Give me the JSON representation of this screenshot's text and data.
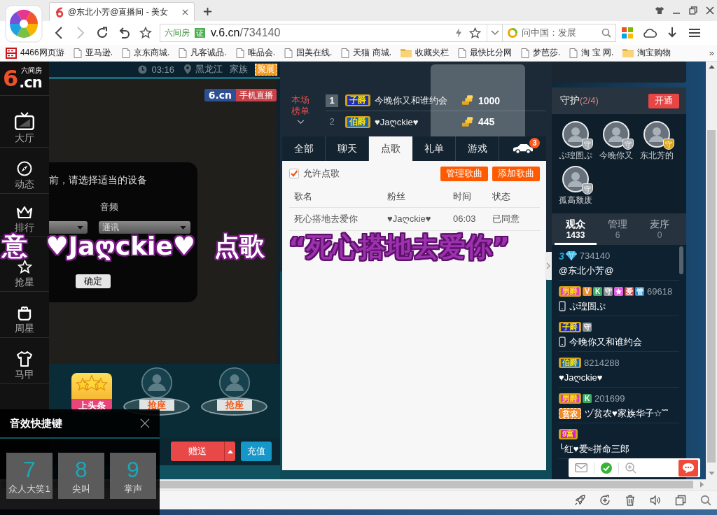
{
  "browser": {
    "tabs": [
      {
        "title": "@东北小芳@直播间 - 美女",
        "selected": true
      }
    ],
    "address": {
      "site": "六间房",
      "cert": "证",
      "host": "v.6.cn",
      "path": "/734140"
    },
    "search": {
      "value": "问中国：发展"
    },
    "bookmarks": [
      {
        "label": "4466网页游",
        "kind": "game"
      },
      {
        "label": "亚马逊.",
        "kind": "page"
      },
      {
        "label": "京东商城.",
        "kind": "page"
      },
      {
        "label": "凡客诚品.",
        "kind": "page"
      },
      {
        "label": "唯品会.",
        "kind": "page"
      },
      {
        "label": "国美在线.",
        "kind": "page"
      },
      {
        "label": "天猫 商城.",
        "kind": "page"
      },
      {
        "label": "收藏夹栏",
        "kind": "folder"
      },
      {
        "label": "最快比分网",
        "kind": "page"
      },
      {
        "label": "梦芭莎.",
        "kind": "page"
      },
      {
        "label": "淘 宝 网.",
        "kind": "page"
      },
      {
        "label": "淘宝购物",
        "kind": "folder"
      }
    ],
    "bookmarks_more": "»"
  },
  "room": {
    "sidebar": {
      "logo": {
        "mark": "6",
        "domain": ".cn",
        "name": "六间房"
      },
      "items": [
        {
          "label": "大厅",
          "kind": "tv"
        },
        {
          "label": "动态",
          "kind": "compass"
        },
        {
          "label": "排行",
          "kind": "crown"
        },
        {
          "label": "抢星",
          "kind": "star"
        },
        {
          "label": "周星",
          "kind": "bag"
        },
        {
          "label": "马甲",
          "kind": "shirt"
        }
      ]
    },
    "host_bar": {
      "time": "03:16",
      "location": "黑龙江",
      "family": "家族",
      "family_badge": "聚展"
    },
    "video": {
      "badge_brand": "6.cn",
      "badge_label": "手机直播"
    },
    "device_dialog": {
      "prompt": "前，请选择适当的设备",
      "audio_label": "音频",
      "audio_device": "通讯",
      "confirm": "确定"
    },
    "overlay": {
      "request": "意 ♥Jaღckie♥ 点歌",
      "song": "“死心搭地去爱你”"
    },
    "seats": [
      {
        "kind": "headline",
        "label": "上头条"
      },
      {
        "kind": "seat",
        "label": "抢座"
      },
      {
        "kind": "seat",
        "label": "抢座"
      }
    ],
    "gift_bar": {
      "send": "赠送",
      "recharge": "充值"
    },
    "ranking": {
      "label": "本场榜单",
      "rows": [
        {
          "rank": "1",
          "top": true,
          "title": "子爵",
          "color": "#1c2fb8",
          "name": "今晚你又和谁约会",
          "coins": "1000"
        },
        {
          "rank": "2",
          "top": false,
          "title": "伯爵",
          "color": "#1466c8",
          "name": "♥Jaღckie♥",
          "coins": "445"
        }
      ]
    },
    "tabs": [
      {
        "kind": "text",
        "label": "全部",
        "selected": false
      },
      {
        "kind": "text",
        "label": "聊天",
        "selected": false
      },
      {
        "kind": "text",
        "label": "点歌",
        "selected": true
      },
      {
        "kind": "text",
        "label": "礼单",
        "selected": false
      },
      {
        "kind": "text",
        "label": "游戏",
        "selected": false
      },
      {
        "kind": "car",
        "badge": "3",
        "selected": false
      }
    ],
    "songs": {
      "allow": {
        "label": "允许点歌",
        "checked": true
      },
      "buttons": [
        "管理歌曲",
        "添加歌曲"
      ],
      "columns": [
        "歌名",
        "粉丝",
        "时间",
        "状态"
      ],
      "rows": [
        [
          "死心搭地去爱你",
          "♥Jaღckie♥",
          "06:03",
          "已同意"
        ]
      ]
    },
    "guard": {
      "title": "守护",
      "count": "(2/4)",
      "open": "开通",
      "members": [
        {
          "name": "ぷ瑝圄ぷ",
          "badge": "守",
          "color": "#a3a9af"
        },
        {
          "name": "今晚你又",
          "badge": "守",
          "color": "#a3a9af"
        },
        {
          "name": "东北芳的",
          "badge": "守",
          "color": "#d9a520"
        },
        {
          "name": "孤高颓废",
          "badge": "守",
          "color": "#a3a9af"
        }
      ]
    },
    "audience_tabs": [
      {
        "label": "观众",
        "count": "1433",
        "selected": true
      },
      {
        "label": "管理",
        "count": "6",
        "selected": false
      },
      {
        "label": "麦序",
        "count": "0",
        "selected": false
      }
    ],
    "audience": [
      {
        "badges": [
          {
            "kind": "level",
            "text": "3"
          },
          {
            "kind": "diamond"
          }
        ],
        "id": "734140",
        "mobile": false,
        "name": "@东北小芳@"
      },
      {
        "badges": [
          {
            "kind": "title",
            "text": "男爵",
            "color": "#e23fc8"
          },
          {
            "kind": "tag",
            "text": "V",
            "color": "#ef8c2a"
          },
          {
            "kind": "tag",
            "text": "K",
            "color": "#3daa66"
          },
          {
            "kind": "tag",
            "text": "守",
            "color": "#8c9298"
          },
          {
            "kind": "star",
            "color": "#e25be0"
          },
          {
            "kind": "tag",
            "text": "爱",
            "color": "#e84545"
          },
          {
            "kind": "tag",
            "text": "管",
            "color": "#2596d8"
          }
        ],
        "id": "69618",
        "mobile": true,
        "name": "ぷ瑝圄ぷ"
      },
      {
        "badges": [
          {
            "kind": "title",
            "text": "子爵",
            "color": "#1c2fb8"
          },
          {
            "kind": "tag",
            "text": "守",
            "color": "#8c9298"
          }
        ],
        "mobile": true,
        "name": "今晚你又和谁约会"
      },
      {
        "badges": [
          {
            "kind": "title",
            "text": "伯爵",
            "color": "#1466c8"
          }
        ],
        "id": "8214288",
        "mobile": false,
        "name": "♥Jaღckie♥"
      },
      {
        "badges": [
          {
            "kind": "title",
            "text": "男爵",
            "color": "#e23fc8"
          },
          {
            "kind": "tag",
            "text": "K",
            "color": "#3daa66"
          }
        ],
        "id": "201699",
        "mobile": false,
        "family": "贫农",
        "name": "ヅ贫农♥家族华子☆˜˜"
      },
      {
        "badges": [
          {
            "kind": "title",
            "text": "9富",
            "color": "#d21fd6"
          }
        ],
        "mobile": false,
        "name": "╰红♥爱≈拼命三郎"
      }
    ],
    "sound_panel": {
      "title": "音效快捷键",
      "keys": [
        {
          "key": "7",
          "label": "众人大笑1"
        },
        {
          "key": "8",
          "label": "尖叫"
        },
        {
          "key": "9",
          "label": "掌声"
        }
      ]
    }
  }
}
